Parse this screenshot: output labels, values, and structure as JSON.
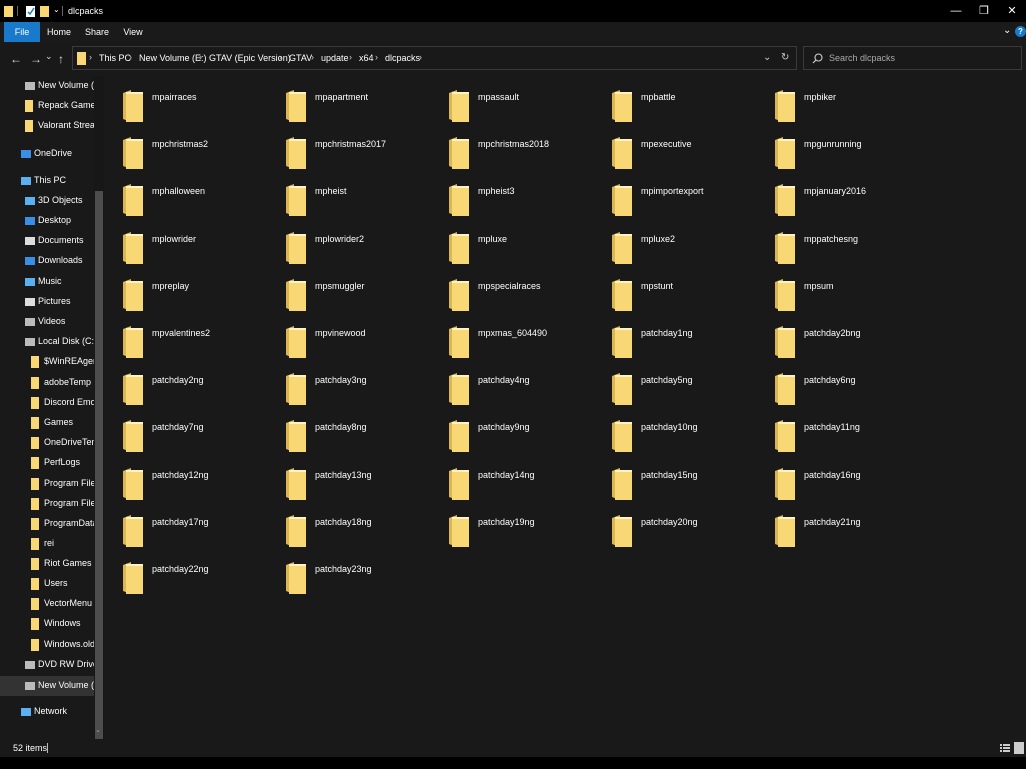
{
  "window": {
    "title": "dlcpacks",
    "minimize": "—",
    "restore": "❐",
    "close": "✕"
  },
  "ribbon": {
    "tabs": [
      "File",
      "Home",
      "Share",
      "View"
    ],
    "expand_icon": "chevron-down-icon",
    "help_label": "?"
  },
  "nav": {
    "back": "←",
    "forward": "→",
    "recent": "⌄",
    "up": "↑",
    "breadcrumbs": [
      "This PC",
      "New Volume (E:)",
      "GTAV (Epic Version)",
      "GTAV",
      "update",
      "x64",
      "dlcpacks"
    ],
    "address_dropdown": "⌄",
    "refresh": "↻",
    "search_placeholder": "Search dlcpacks"
  },
  "sidebar": {
    "items": [
      {
        "label": "New Volume (E:)",
        "icon": "drive-icon",
        "indent": 1
      },
      {
        "label": "Repack Games",
        "icon": "folder-icon",
        "indent": 1
      },
      {
        "label": "Valorant Stream",
        "icon": "folder-icon",
        "indent": 1
      },
      {
        "label": "OneDrive",
        "icon": "cloud-icon",
        "indent": 0
      },
      {
        "label": "This PC",
        "icon": "computer-icon",
        "indent": 0
      },
      {
        "label": "3D Objects",
        "icon": "cube-icon",
        "indent": 1
      },
      {
        "label": "Desktop",
        "icon": "desktop-icon",
        "indent": 1
      },
      {
        "label": "Documents",
        "icon": "documents-icon",
        "indent": 1
      },
      {
        "label": "Downloads",
        "icon": "download-icon",
        "indent": 1
      },
      {
        "label": "Music",
        "icon": "music-icon",
        "indent": 1
      },
      {
        "label": "Pictures",
        "icon": "pictures-icon",
        "indent": 1
      },
      {
        "label": "Videos",
        "icon": "video-icon",
        "indent": 1
      },
      {
        "label": "Local Disk (C:)",
        "icon": "drive-icon",
        "indent": 1
      },
      {
        "label": "$WinREAgent",
        "icon": "folder-icon",
        "indent": 2
      },
      {
        "label": "adobeTemp",
        "icon": "folder-icon",
        "indent": 2
      },
      {
        "label": "Discord Emojis",
        "icon": "folder-icon",
        "indent": 2
      },
      {
        "label": "Games",
        "icon": "folder-icon",
        "indent": 2
      },
      {
        "label": "OneDriveTemp",
        "icon": "folder-icon",
        "indent": 2
      },
      {
        "label": "PerfLogs",
        "icon": "folder-icon",
        "indent": 2
      },
      {
        "label": "Program Files",
        "icon": "folder-icon",
        "indent": 2
      },
      {
        "label": "Program Files (",
        "icon": "folder-icon",
        "indent": 2
      },
      {
        "label": "ProgramData",
        "icon": "folder-icon",
        "indent": 2
      },
      {
        "label": "rei",
        "icon": "folder-icon",
        "indent": 2
      },
      {
        "label": "Riot Games",
        "icon": "folder-icon",
        "indent": 2
      },
      {
        "label": "Users",
        "icon": "folder-icon",
        "indent": 2
      },
      {
        "label": "VectorMenu",
        "icon": "folder-icon",
        "indent": 2
      },
      {
        "label": "Windows",
        "icon": "folder-icon",
        "indent": 2
      },
      {
        "label": "Windows.old",
        "icon": "folder-icon",
        "indent": 2
      },
      {
        "label": "DVD RW Drive (D",
        "icon": "dvd-drive-icon",
        "indent": 1
      },
      {
        "label": "New Volume (E:)",
        "icon": "drive-icon",
        "indent": 1,
        "selected": true
      },
      {
        "label": "Network",
        "icon": "network-icon",
        "indent": 0
      }
    ]
  },
  "folders": [
    "mpairraces",
    "mpapartment",
    "mpassault",
    "mpbattle",
    "mpbiker",
    "mpchristmas2",
    "mpchristmas2017",
    "mpchristmas2018",
    "mpexecutive",
    "mpgunrunning",
    "mphalloween",
    "mpheist",
    "mpheist3",
    "mpimportexport",
    "mpjanuary2016",
    "mplowrider",
    "mplowrider2",
    "mpluxe",
    "mpluxe2",
    "mppatchesng",
    "mpreplay",
    "mpsmuggler",
    "mpspecialraces",
    "mpstunt",
    "mpsum",
    "mpvalentines2",
    "mpvinewood",
    "mpxmas_604490",
    "patchday1ng",
    "patchday2bng",
    "patchday2ng",
    "patchday3ng",
    "patchday4ng",
    "patchday5ng",
    "patchday6ng",
    "patchday7ng",
    "patchday8ng",
    "patchday9ng",
    "patchday10ng",
    "patchday11ng",
    "patchday12ng",
    "patchday13ng",
    "patchday14ng",
    "patchday15ng",
    "patchday16ng",
    "patchday17ng",
    "patchday18ng",
    "patchday19ng",
    "patchday20ng",
    "patchday21ng",
    "patchday22ng",
    "patchday23ng"
  ],
  "status": {
    "item_count": "52 items"
  },
  "colors": {
    "background": "#191919",
    "accent": "#1979ca",
    "folder": "#f8d775",
    "folder_dark": "#dcb650"
  }
}
